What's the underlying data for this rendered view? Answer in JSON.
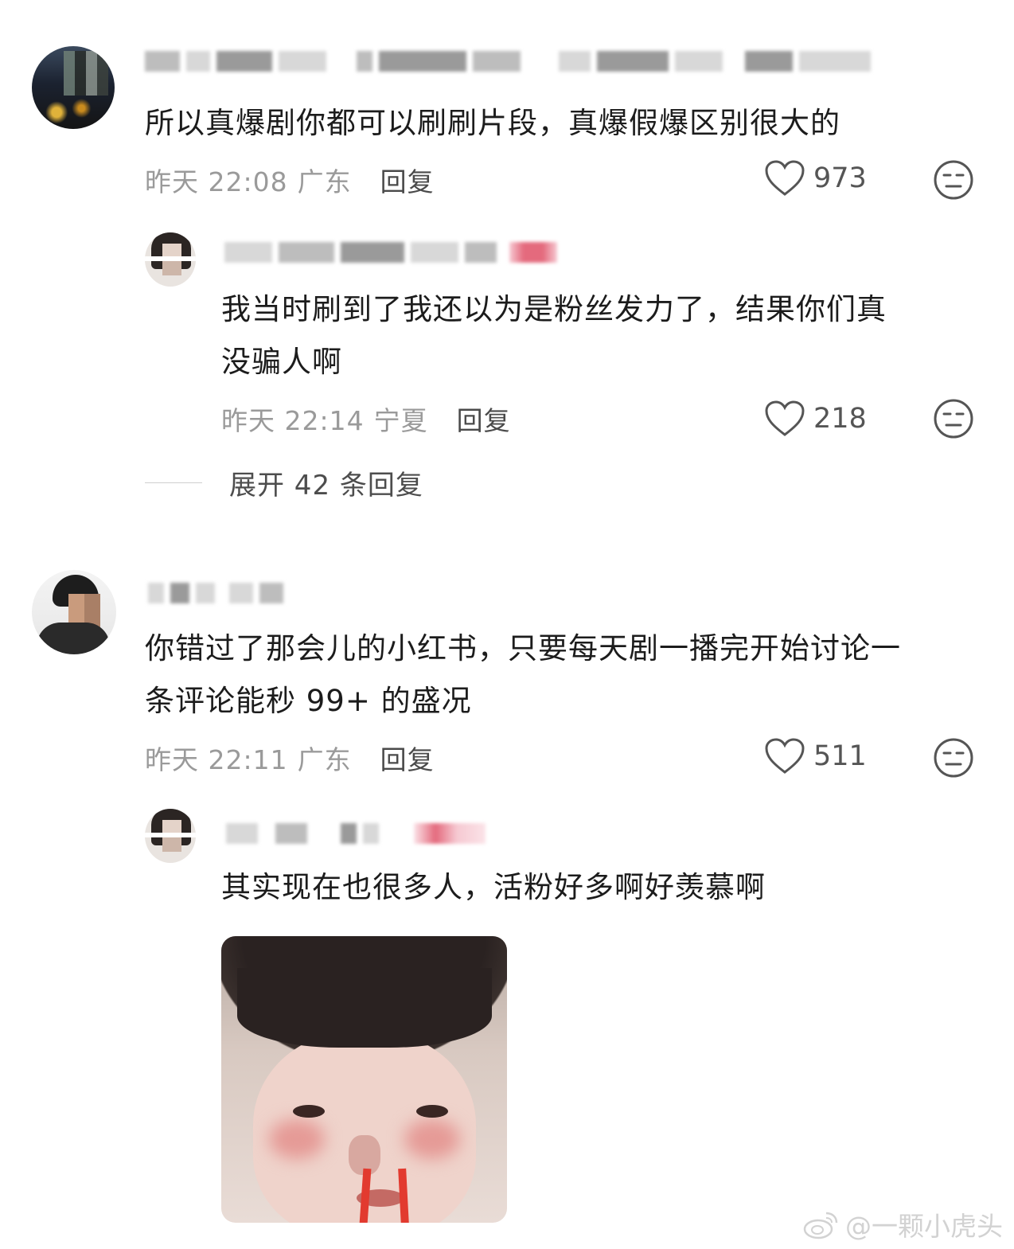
{
  "comments": [
    {
      "text": "所以真爆剧你都可以刷刷片段，真爆假爆区别很大的",
      "time": "昨天 22:08",
      "location": "广东",
      "reply_label": "回复",
      "likes": "973"
    },
    {
      "text_line1": "我当时刷到了我还以为是粉丝发力了，结果你们真",
      "text_line2": "没骗人啊",
      "time": "昨天 22:14",
      "location": "宁夏",
      "reply_label": "回复",
      "likes": "218"
    },
    {
      "text_line1": "你错过了那会儿的小红书，只要每天剧一播完开始讨论一",
      "text_line2": "条评论能秒 99+ 的盛况",
      "time": "昨天 22:11",
      "location": "广东",
      "reply_label": "回复",
      "likes": "511"
    },
    {
      "text": "其实现在也很多人，活粉好多啊好羡慕啊"
    }
  ],
  "expand_replies": "展开 42 条回复",
  "watermark": "@一颗小虎头",
  "icons": [
    "heart-outline-icon",
    "neutral-face-icon",
    "weibo-logo-icon"
  ],
  "colors": {
    "text": "#1c1c1c",
    "meta": "#9a9a9a",
    "reply": "#4a4a4a",
    "author_badge": "#e46a7d"
  }
}
